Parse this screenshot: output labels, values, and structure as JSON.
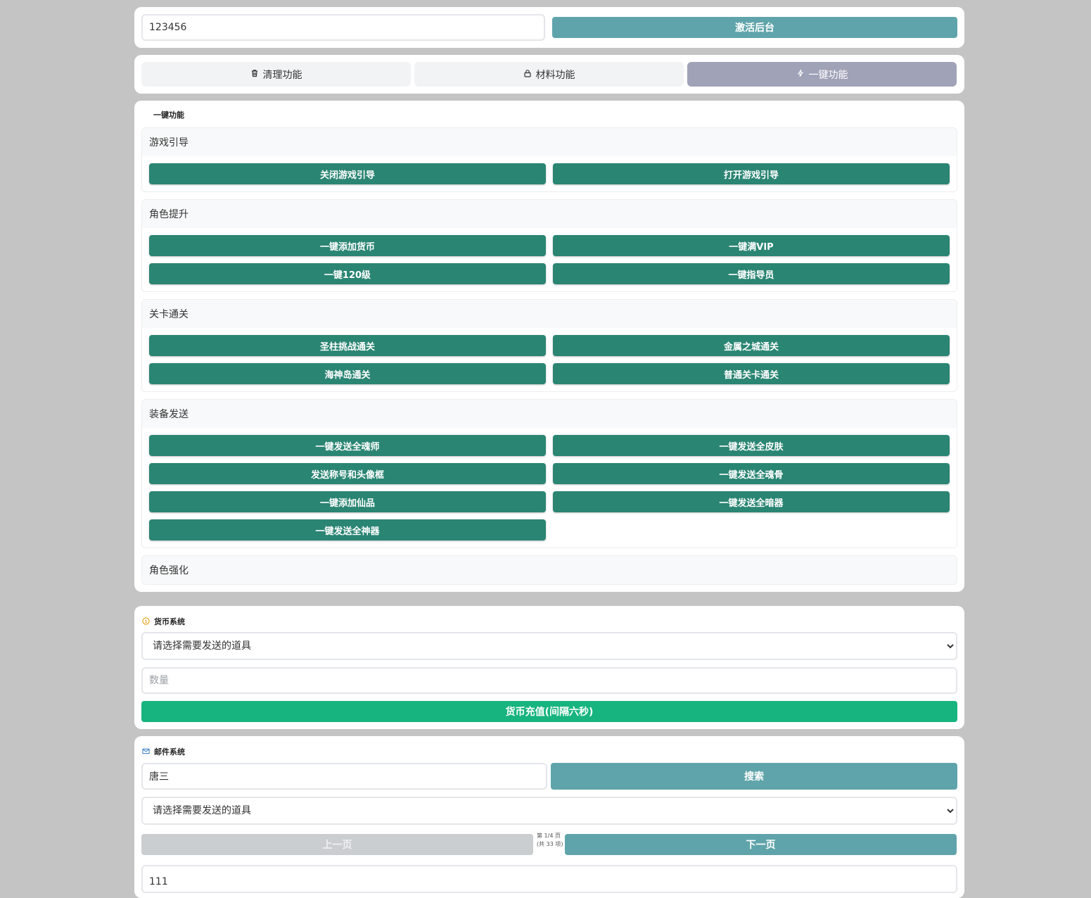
{
  "activation": {
    "code_value": "123456",
    "activate_label": "激活后台"
  },
  "tabs": [
    {
      "label": "清理功能",
      "icon": "trash-icon"
    },
    {
      "label": "材料功能",
      "icon": "lock-icon"
    },
    {
      "label": "一键功能",
      "icon": "bolt-icon",
      "active": true
    }
  ],
  "onekey": {
    "title": "一键功能",
    "groups": [
      {
        "title": "游戏引导",
        "buttons": [
          "关闭游戏引导",
          "打开游戏引导"
        ]
      },
      {
        "title": "角色提升",
        "buttons": [
          "一键添加货币",
          "一键满VIP",
          "一键120级",
          "一键指导员"
        ]
      },
      {
        "title": "关卡通关",
        "buttons": [
          "圣柱挑战通关",
          "金属之城通关",
          "海神岛通关",
          "普通关卡通关"
        ]
      },
      {
        "title": "装备发送",
        "buttons": [
          "一键发送全魂师",
          "一键发送全皮肤",
          "发送称号和头像框",
          "一键发送全魂骨",
          "一键添加仙品",
          "一键发送全暗器",
          "一键发送全神器"
        ]
      },
      {
        "title": "角色强化",
        "buttons": []
      }
    ]
  },
  "currency": {
    "title": "货币系统",
    "select_value": "请选择需要发送的道具",
    "quantity_placeholder": "数量",
    "recharge_label": "货币充值(间隔六秒)"
  },
  "mail": {
    "title": "邮件系统",
    "search_value": "唐三",
    "search_label": "搜索",
    "select_value": "请选择需要发送的道具",
    "prev_label": "上一页",
    "page_info": "第 1/4 页 (共 33 项)",
    "next_label": "下一页",
    "extra_value": "111"
  },
  "colors": {
    "background": "#c4c4c4",
    "teal_button": "#5fa4aa",
    "green_button": "#2a8573",
    "bright_green_button": "#17b47f",
    "active_tab": "#a0a2b8"
  }
}
